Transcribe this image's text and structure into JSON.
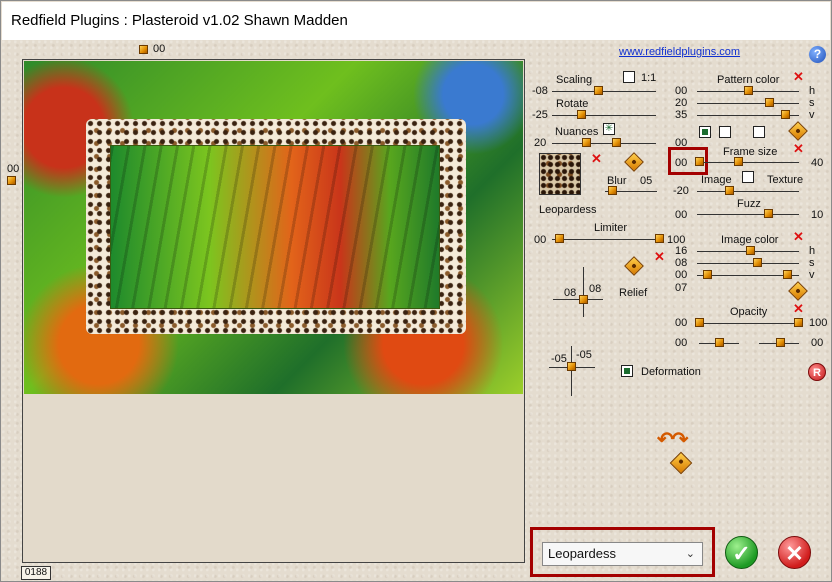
{
  "window": {
    "title": "Redfield Plugins : Plasteroid v1.02   Shawn Madden"
  },
  "preview": {
    "top_offset": "00",
    "left_offset": "00",
    "counter": "0188"
  },
  "header": {
    "link": "www.redfieldplugins.com",
    "help_label": "?"
  },
  "left_controls": {
    "scaling": {
      "label": "Scaling",
      "value": "-08",
      "checkbox_label": "1:1"
    },
    "rotate": {
      "label": "Rotate",
      "value": "-25"
    },
    "nuances": {
      "label": "Nuances",
      "value": "20",
      "icon_label": "✳"
    },
    "texture_name": "Leopardess",
    "blur": {
      "label": "Blur",
      "value": "05"
    },
    "limiter": {
      "label": "Limiter",
      "min": "00",
      "max": "100"
    },
    "relief": {
      "label": "Relief",
      "x": "08",
      "y": "08"
    },
    "deformation": {
      "label": "Deformation",
      "x": "-05",
      "y": "-05"
    }
  },
  "right_controls": {
    "pattern_color": {
      "label": "Pattern color",
      "rows": [
        {
          "value": "00",
          "axis": "h"
        },
        {
          "value": "20",
          "axis": "s"
        },
        {
          "value": "35",
          "axis": "v"
        }
      ]
    },
    "pattern_min": "00",
    "frame_size": {
      "label": "Frame size",
      "min": "00",
      "max": "40"
    },
    "image_texture": {
      "image_label": "Image",
      "texture_label": "Texture",
      "value": "-20"
    },
    "fuzz": {
      "label": "Fuzz",
      "min": "00",
      "max": "10"
    },
    "image_color": {
      "label": "Image color",
      "rows": [
        {
          "value": "16",
          "axis": "h"
        },
        {
          "value": "08",
          "axis": "s"
        },
        {
          "value": "00",
          "axis": "v"
        }
      ],
      "extra": "07"
    },
    "opacity": {
      "label": "Opacity",
      "min": "00",
      "max": "100",
      "min2": "00",
      "max2": "00"
    },
    "r_label": "R"
  },
  "bottom": {
    "preset_selected": "Leopardess",
    "ok_label": "✓",
    "cancel_label": "✕"
  }
}
